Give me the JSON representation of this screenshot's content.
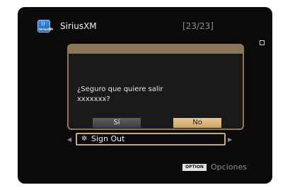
{
  "header": {
    "service_icon": "siriusxm-logo-icon",
    "service_icon_text": "SiriusXM",
    "title": "SiriusXM",
    "track_counter": "[23/23]"
  },
  "dialog": {
    "message": "¿Seguro que quiere salir\nxxxxxxx?",
    "yes_label": "Sí",
    "no_label": "No",
    "selected": "No"
  },
  "menu": {
    "item_icon": "gear-icon",
    "item_label": "Sign Out"
  },
  "footer": {
    "option_badge": "OPTION",
    "option_label": "Opciones"
  },
  "colors": {
    "accent": "#c9a466",
    "background": "#0b0b0b",
    "dialog_border": "#8a7658"
  }
}
